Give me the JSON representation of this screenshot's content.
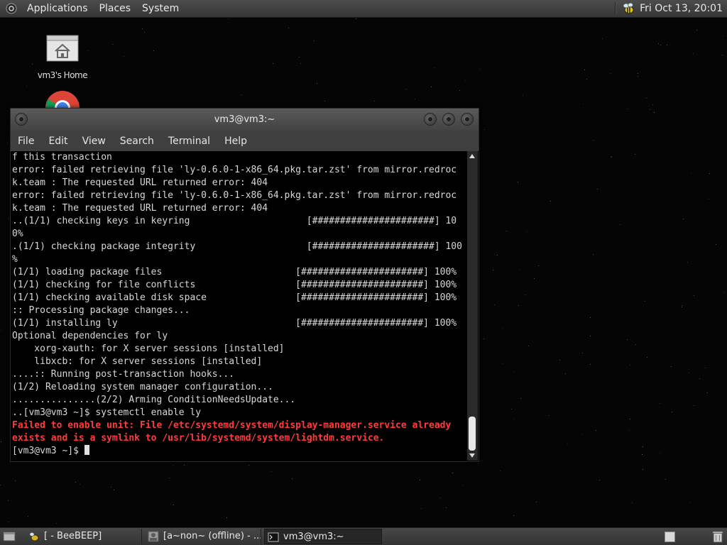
{
  "top_panel": {
    "menu_applications": "Applications",
    "menu_places": "Places",
    "menu_system": "System",
    "clock": "Fri Oct 13, 20:01"
  },
  "desktop_icons": {
    "home_label": "vm3's Home"
  },
  "terminal": {
    "title": "vm3@vm3:~",
    "menu": [
      "File",
      "Edit",
      "View",
      "Search",
      "Terminal",
      "Help"
    ],
    "lines": [
      {
        "text": "f this transaction",
        "type": "normal"
      },
      {
        "text": "error: failed retrieving file 'ly-0.6.0-1-x86_64.pkg.tar.zst' from mirror.redroc",
        "type": "normal"
      },
      {
        "text": "k.team : The requested URL returned error: 404",
        "type": "normal"
      },
      {
        "text": "error: failed retrieving file 'ly-0.6.0-1-x86_64.pkg.tar.zst' from mirror.redroc",
        "type": "normal"
      },
      {
        "text": "k.team : The requested URL returned error: 404",
        "type": "normal"
      },
      {
        "text": "..(1/1) checking keys in keyring                     [######################] 10",
        "type": "normal"
      },
      {
        "text": "0%",
        "type": "normal"
      },
      {
        "text": ".(1/1) checking package integrity                    [######################] 100",
        "type": "normal"
      },
      {
        "text": "%",
        "type": "normal"
      },
      {
        "text": "(1/1) loading package files                        [######################] 100%",
        "type": "normal"
      },
      {
        "text": "(1/1) checking for file conflicts                  [######################] 100%",
        "type": "normal"
      },
      {
        "text": "(1/1) checking available disk space                [######################] 100%",
        "type": "normal"
      },
      {
        "text": ":: Processing package changes...",
        "type": "normal"
      },
      {
        "text": "(1/1) installing ly                                [######################] 100%",
        "type": "normal"
      },
      {
        "text": "Optional dependencies for ly",
        "type": "normal"
      },
      {
        "text": "    xorg-xauth: for X server sessions [installed]",
        "type": "normal"
      },
      {
        "text": "    libxcb: for X server sessions [installed]",
        "type": "normal"
      },
      {
        "text": "....:: Running post-transaction hooks...",
        "type": "normal"
      },
      {
        "text": "(1/2) Reloading system manager configuration...",
        "type": "normal"
      },
      {
        "text": "...............(2/2) Arming ConditionNeedsUpdate...",
        "type": "normal"
      },
      {
        "text": "..[vm3@vm3 ~]$ systemctl enable ly",
        "type": "normal"
      },
      {
        "text": "Failed to enable unit: File /etc/systemd/system/display-manager.service already",
        "type": "error"
      },
      {
        "text": "exists and is a symlink to /usr/lib/systemd/system/lightdm.service.",
        "type": "error"
      },
      {
        "text": "[vm3@vm3 ~]$ ",
        "type": "prompt"
      }
    ]
  },
  "taskbar": {
    "tasks": [
      {
        "label": "[ - BeeBEEP]"
      },
      {
        "label": "[a~non~ (offline) - ..."
      },
      {
        "label": "vm3@vm3:~"
      }
    ]
  },
  "colors": {
    "error_text": "#ff3b3b",
    "terminal_text": "#d8d8d8",
    "panel_bg": "#3f3f3f"
  }
}
